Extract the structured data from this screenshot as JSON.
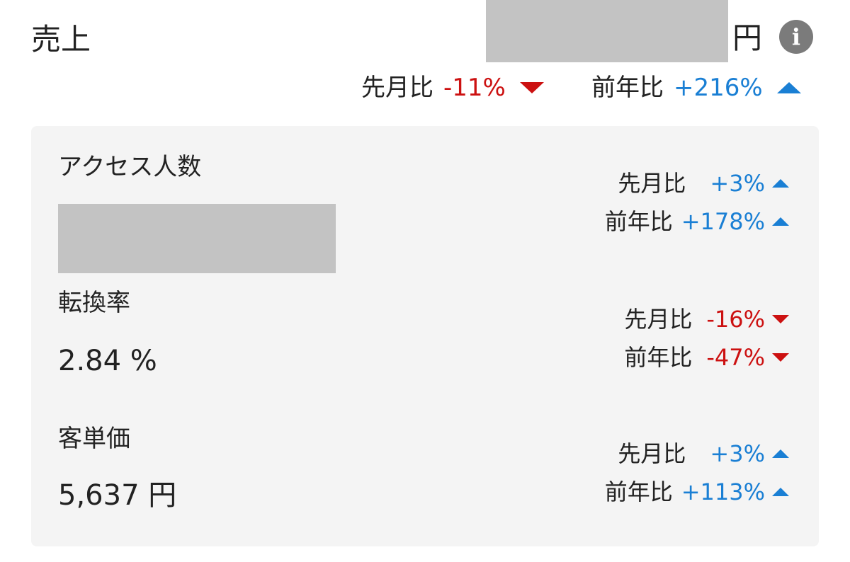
{
  "sales": {
    "title": "売上",
    "unit": "円",
    "info_icon": "info-icon",
    "month_label": "先月比",
    "month_value": "-11%",
    "month_dir": "down",
    "year_label": "前年比",
    "year_value": "+216%",
    "year_dir": "up"
  },
  "metrics": [
    {
      "label": "アクセス人数",
      "value": "",
      "month_label": "先月比",
      "month_value": "+3%",
      "month_dir": "up",
      "year_label": "前年比",
      "year_value": "+178%",
      "year_dir": "up"
    },
    {
      "label": "転換率",
      "value": "2.84 %",
      "month_label": "先月比",
      "month_value": "-16%",
      "month_dir": "down",
      "year_label": "前年比",
      "year_value": "-47%",
      "year_dir": "down"
    },
    {
      "label": "客単価",
      "value": "5,637 円",
      "month_label": "先月比",
      "month_value": "+3%",
      "month_dir": "up",
      "year_label": "前年比",
      "year_value": "+113%",
      "year_dir": "up"
    }
  ],
  "colors": {
    "up": "#1a7fd4",
    "down": "#cc1111",
    "panel": "#f4f4f4",
    "redacted": "#c3c3c3"
  }
}
